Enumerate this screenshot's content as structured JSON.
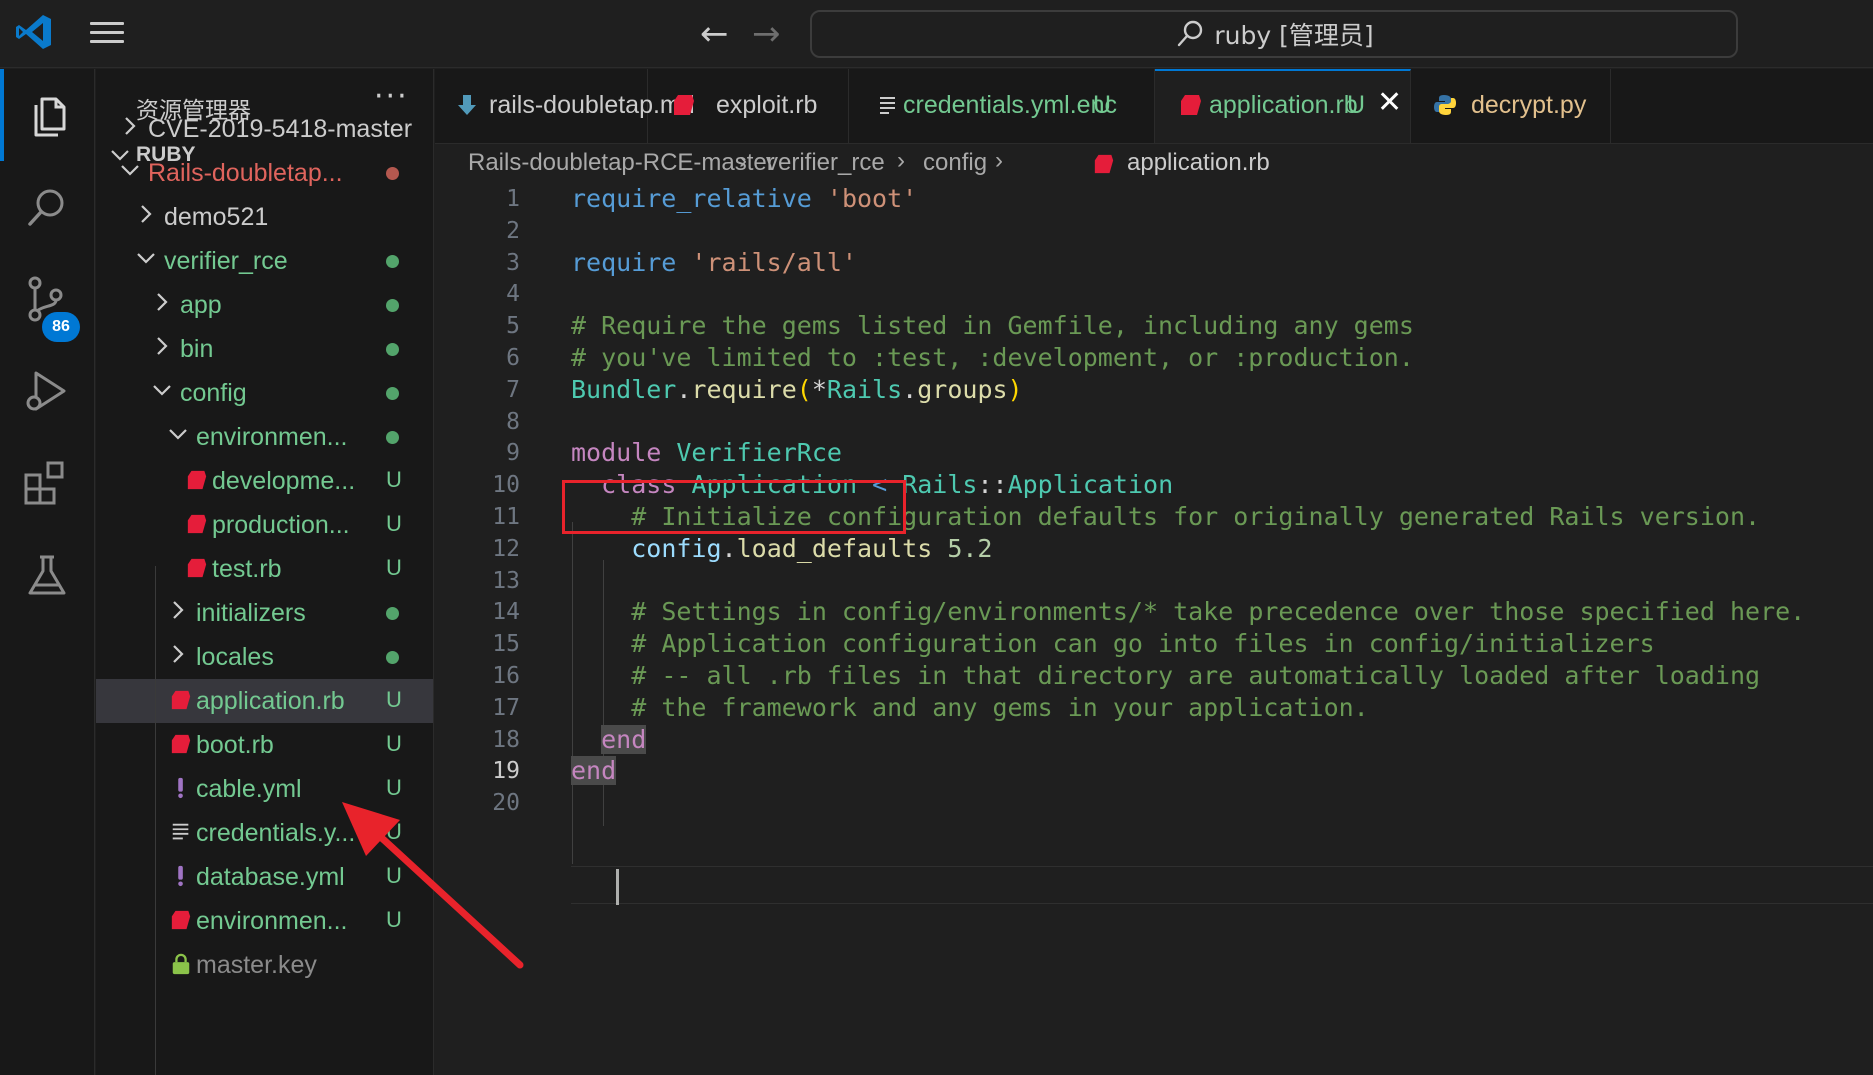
{
  "titlebar": {
    "search_text": "ruby [管理员]",
    "back_glyph": "←",
    "forward_glyph": "→"
  },
  "activity": {
    "source_control_badge": "86",
    "icons": [
      "explorer-icon",
      "search-icon",
      "source-control-icon",
      "run-debug-icon",
      "extensions-icon",
      "testing-icon"
    ]
  },
  "sidebar": {
    "title": "资源管理器",
    "more": "···",
    "section": "RUBY",
    "items": [
      {
        "name": "CVE-2019-5418-master",
        "type": "folder",
        "expanded": false,
        "color": "white",
        "status": ""
      },
      {
        "name": "Rails-doubletap...",
        "type": "folder",
        "expanded": true,
        "color": "red",
        "status": "dot-red"
      },
      {
        "name": "demo521",
        "type": "folder",
        "expanded": false,
        "color": "white",
        "status": ""
      },
      {
        "name": "verifier_rce",
        "type": "folder",
        "expanded": true,
        "color": "green",
        "status": "dot-green"
      },
      {
        "name": "app",
        "type": "folder",
        "expanded": false,
        "color": "green",
        "status": "dot-green"
      },
      {
        "name": "bin",
        "type": "folder",
        "expanded": false,
        "color": "green",
        "status": "dot-green"
      },
      {
        "name": "config",
        "type": "folder",
        "expanded": true,
        "color": "green",
        "status": "dot-green"
      },
      {
        "name": "environmen...",
        "type": "folder",
        "expanded": true,
        "color": "green",
        "status": "dot-green"
      },
      {
        "name": "developme...",
        "type": "ruby",
        "color": "green",
        "status": "U"
      },
      {
        "name": "production...",
        "type": "ruby",
        "color": "green",
        "status": "U"
      },
      {
        "name": "test.rb",
        "type": "ruby",
        "color": "green",
        "status": "U"
      },
      {
        "name": "initializers",
        "type": "folder",
        "expanded": false,
        "color": "green",
        "status": "dot-green"
      },
      {
        "name": "locales",
        "type": "folder",
        "expanded": false,
        "color": "green",
        "status": "dot-green"
      },
      {
        "name": "application.rb",
        "type": "ruby",
        "color": "green",
        "status": "U",
        "selected": true
      },
      {
        "name": "boot.rb",
        "type": "ruby",
        "color": "green",
        "status": "U"
      },
      {
        "name": "cable.yml",
        "type": "yaml",
        "color": "green",
        "status": "U"
      },
      {
        "name": "credentials.y...",
        "type": "text",
        "color": "green",
        "status": "U"
      },
      {
        "name": "database.yml",
        "type": "yaml",
        "color": "green",
        "status": "U"
      },
      {
        "name": "environmen...",
        "type": "ruby",
        "color": "green",
        "status": "U"
      },
      {
        "name": "master.key",
        "type": "lock",
        "color": "gray",
        "status": ""
      }
    ]
  },
  "tabs": [
    {
      "label": "rails-doubletap.md",
      "icon": "markdown-icon",
      "color": "#cccccc",
      "mark": ""
    },
    {
      "label": "exploit.rb",
      "icon": "ruby-icon",
      "color": "#cccccc",
      "mark": ""
    },
    {
      "label": "credentials.yml.enc",
      "icon": "text-file-icon",
      "color": "#73c991",
      "mark": "U"
    },
    {
      "label": "application.rb",
      "icon": "ruby-icon",
      "color": "#73c991",
      "mark": "U",
      "active": true,
      "close": "✕"
    },
    {
      "label": "decrypt.py",
      "icon": "python-icon",
      "color": "#e2c08d",
      "mark": ""
    }
  ],
  "breadcrumb": [
    "Rails-doubletap-RCE-master",
    "verifier_rce",
    "config",
    "application.rb"
  ],
  "breadcrumb_sep": "›",
  "editor": {
    "current_line": 19,
    "line_numbers": [
      "1",
      "2",
      "3",
      "4",
      "5",
      "6",
      "7",
      "8",
      "9",
      "10",
      "11",
      "12",
      "13",
      "14",
      "15",
      "16",
      "17",
      "18",
      "19",
      "20"
    ],
    "lines": [
      [
        [
          "k",
          "require_relative"
        ],
        [
          "p",
          " "
        ],
        [
          "s",
          "'boot'"
        ]
      ],
      [],
      [
        [
          "k",
          "require"
        ],
        [
          "p",
          " "
        ],
        [
          "s",
          "'rails/all'"
        ]
      ],
      [],
      [
        [
          "cm",
          "# Require the gems listed in Gemfile, including any gems"
        ]
      ],
      [
        [
          "cm",
          "# you've limited to :test, :development, or :production."
        ]
      ],
      [
        [
          "cl",
          "Bundler"
        ],
        [
          "p",
          "."
        ],
        [
          "fn",
          "require"
        ],
        [
          "par",
          "("
        ],
        [
          "p",
          "*"
        ],
        [
          "cl",
          "Rails"
        ],
        [
          "p",
          "."
        ],
        [
          "fn",
          "groups"
        ],
        [
          "par",
          ")"
        ]
      ],
      [],
      [
        [
          "m",
          "module"
        ],
        [
          "p",
          " "
        ],
        [
          "cl",
          "VerifierRce"
        ]
      ],
      [
        [
          "p",
          "  "
        ],
        [
          "m",
          "class"
        ],
        [
          "p",
          " "
        ],
        [
          "cl",
          "Application"
        ],
        [
          "p",
          " "
        ],
        [
          "k",
          "<"
        ],
        [
          "p",
          " "
        ],
        [
          "cl",
          "Rails"
        ],
        [
          "p",
          "::"
        ],
        [
          "cl",
          "Application"
        ]
      ],
      [
        [
          "p",
          "    "
        ],
        [
          "cm",
          "# Initialize configuration defaults for originally generated Rails version."
        ]
      ],
      [
        [
          "p",
          "    "
        ],
        [
          "v",
          "config"
        ],
        [
          "p",
          "."
        ],
        [
          "fn",
          "load_defaults"
        ],
        [
          "p",
          " "
        ],
        [
          "n",
          "5.2"
        ]
      ],
      [],
      [
        [
          "p",
          "    "
        ],
        [
          "cm",
          "# Settings in config/environments/* take precedence over those specified here."
        ]
      ],
      [
        [
          "p",
          "    "
        ],
        [
          "cm",
          "# Application configuration can go into files in config/initializers"
        ]
      ],
      [
        [
          "p",
          "    "
        ],
        [
          "cm",
          "# -- all .rb files in that directory are automatically loaded after loading"
        ]
      ],
      [
        [
          "p",
          "    "
        ],
        [
          "cm",
          "# the framework and any gems in your application."
        ]
      ],
      [
        [
          "p",
          "  "
        ],
        [
          "m endbg",
          "end"
        ]
      ],
      [
        [
          "m endbg",
          "end"
        ]
      ],
      []
    ]
  },
  "colors": {
    "accent": "#0078d4",
    "highlight_box": "#e8232b",
    "arrow": "#e8232b"
  }
}
